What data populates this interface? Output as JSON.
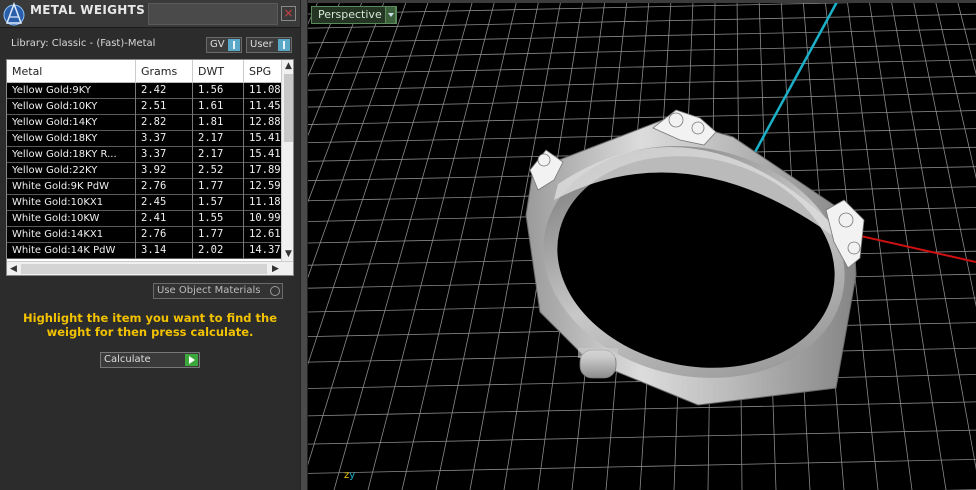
{
  "panel": {
    "title": "METAL WEIGHTS",
    "close": "×",
    "library_label": "Library: Classic - (Fast)-Metal",
    "gv_label": "GV",
    "user_label": "User",
    "use_object_materials": "Use Object Materials",
    "hint": "Highlight the item you want to find the weight for then press calculate.",
    "calculate_label": "Calculate"
  },
  "table": {
    "headers": [
      "Metal",
      "Grams",
      "DWT",
      "SPG"
    ],
    "rows": [
      [
        "Yellow Gold:9KY",
        "2.42",
        "1.56",
        "11.08"
      ],
      [
        "Yellow Gold:10KY",
        "2.51",
        "1.61",
        "11.45"
      ],
      [
        "Yellow Gold:14KY",
        "2.82",
        "1.81",
        "12.88"
      ],
      [
        "Yellow Gold:18KY",
        "3.37",
        "2.17",
        "15.41"
      ],
      [
        "Yellow Gold:18KY R...",
        "3.37",
        "2.17",
        "15.41"
      ],
      [
        "Yellow Gold:22KY",
        "3.92",
        "2.52",
        "17.89"
      ],
      [
        "White Gold:9K PdW",
        "2.76",
        "1.77",
        "12.59"
      ],
      [
        "White Gold:10KX1",
        "2.45",
        "1.57",
        "11.18"
      ],
      [
        "White Gold:10KW",
        "2.41",
        "1.55",
        "10.99"
      ],
      [
        "White Gold:14KX1",
        "2.76",
        "1.77",
        "12.61"
      ],
      [
        "White Gold:14K PdW",
        "3.14",
        "2.02",
        "14.37"
      ]
    ]
  },
  "viewport": {
    "view_mode": "Perspective",
    "axis_z": "z",
    "axis_y": "y",
    "colors": {
      "y_axis": "#1ab0c8",
      "x_axis": "#d01010",
      "grid": "#8a8a8a"
    }
  }
}
